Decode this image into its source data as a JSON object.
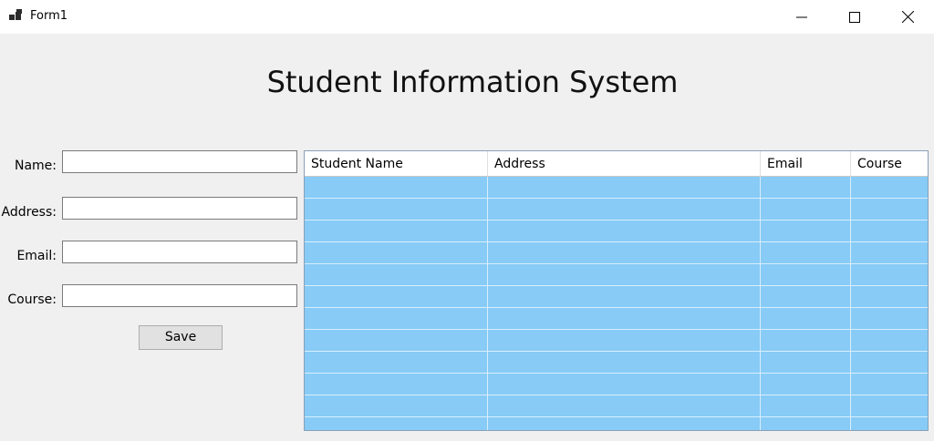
{
  "window": {
    "title": "Form1",
    "controls": [
      "minimize-icon",
      "maximize-icon",
      "close-icon"
    ]
  },
  "header": {
    "title": "Student Information System"
  },
  "form": {
    "fields": [
      {
        "label": "Name:",
        "value": "",
        "placeholder": ""
      },
      {
        "label": "Address:",
        "value": "",
        "placeholder": ""
      },
      {
        "label": "Email:",
        "value": "",
        "placeholder": ""
      },
      {
        "label": "Course:",
        "value": "",
        "placeholder": ""
      }
    ],
    "save_label": "Save"
  },
  "grid": {
    "columns": [
      "Student Name",
      "Address",
      "Email",
      "Course"
    ],
    "rows": [],
    "row_color": "#87cbf6"
  }
}
